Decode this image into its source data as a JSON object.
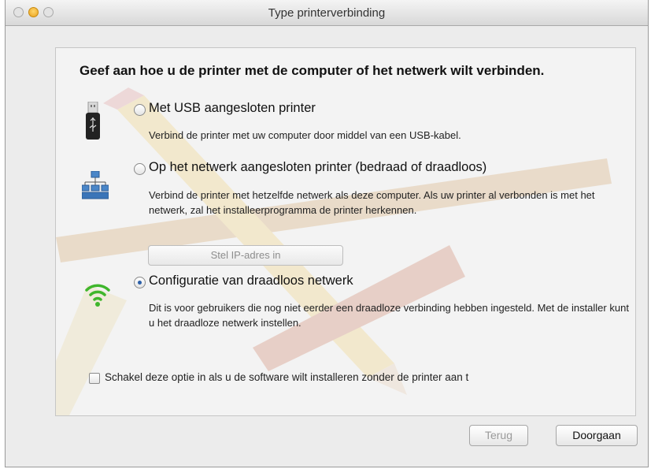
{
  "window": {
    "title": "Type printerverbinding"
  },
  "panel": {
    "heading": "Geef aan hoe u de printer met de computer of het netwerk wilt verbinden.",
    "options": [
      {
        "label": "Met USB aangesloten printer",
        "description": "Verbind de printer met uw computer door middel van een USB-kabel.",
        "selected": false,
        "icon": "usb-icon"
      },
      {
        "label": "Op het netwerk aangesloten printer (bedraad of draadloos)",
        "description": "Verbind de printer met hetzelfde netwerk als deze computer. Als uw printer al verbonden is met het netwerk, zal het installeerprogramma de printer herkennen.",
        "selected": false,
        "icon": "network-icon"
      },
      {
        "label": "Configuratie van draadloos netwerk",
        "description": "Dit is voor gebruikers die nog niet eerder een draadloze verbinding hebben ingesteld. Met de installer kunt u het draadloze netwerk instellen.",
        "selected": true,
        "icon": "wifi-icon"
      }
    ],
    "ip_button": "Stel IP-adres in",
    "checkbox": {
      "label": "Schakel deze optie in als u de software wilt installeren zonder de printer aan t",
      "checked": false
    }
  },
  "footer": {
    "back_label": "Terug",
    "next_label": "Doorgaan"
  },
  "colors": {
    "accent": "#2b5fa8",
    "wifi": "#3fb62c",
    "disabled_text": "#9a9a9a"
  }
}
